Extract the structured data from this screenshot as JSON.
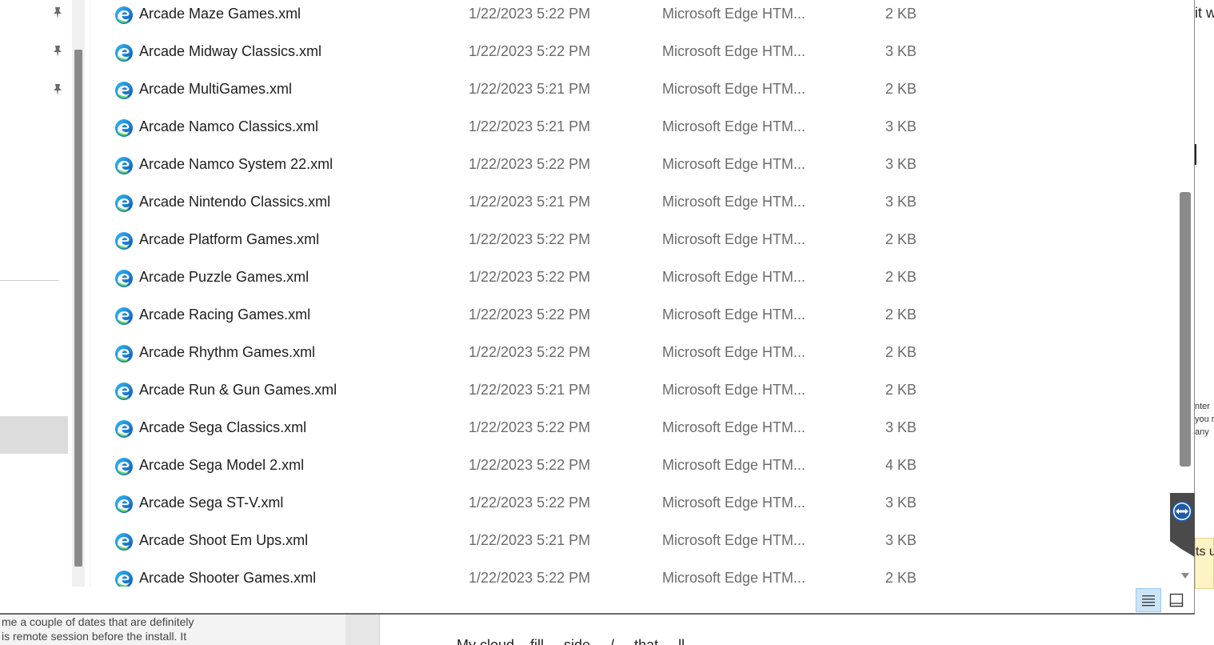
{
  "files": [
    {
      "name": "Arcade Maze Games.xml",
      "date": "1/22/2023 5:22 PM",
      "type": "Microsoft Edge HTM...",
      "size": "2 KB"
    },
    {
      "name": "Arcade Midway Classics.xml",
      "date": "1/22/2023 5:22 PM",
      "type": "Microsoft Edge HTM...",
      "size": "3 KB"
    },
    {
      "name": "Arcade MultiGames.xml",
      "date": "1/22/2023 5:21 PM",
      "type": "Microsoft Edge HTM...",
      "size": "2 KB"
    },
    {
      "name": "Arcade Namco Classics.xml",
      "date": "1/22/2023 5:21 PM",
      "type": "Microsoft Edge HTM...",
      "size": "3 KB"
    },
    {
      "name": "Arcade Namco System 22.xml",
      "date": "1/22/2023 5:22 PM",
      "type": "Microsoft Edge HTM...",
      "size": "3 KB"
    },
    {
      "name": "Arcade Nintendo Classics.xml",
      "date": "1/22/2023 5:21 PM",
      "type": "Microsoft Edge HTM...",
      "size": "3 KB"
    },
    {
      "name": "Arcade Platform Games.xml",
      "date": "1/22/2023 5:22 PM",
      "type": "Microsoft Edge HTM...",
      "size": "2 KB"
    },
    {
      "name": "Arcade Puzzle Games.xml",
      "date": "1/22/2023 5:22 PM",
      "type": "Microsoft Edge HTM...",
      "size": "2 KB"
    },
    {
      "name": "Arcade Racing Games.xml",
      "date": "1/22/2023 5:22 PM",
      "type": "Microsoft Edge HTM...",
      "size": "2 KB"
    },
    {
      "name": "Arcade Rhythm Games.xml",
      "date": "1/22/2023 5:22 PM",
      "type": "Microsoft Edge HTM...",
      "size": "2 KB"
    },
    {
      "name": "Arcade Run & Gun Games.xml",
      "date": "1/22/2023 5:21 PM",
      "type": "Microsoft Edge HTM...",
      "size": "2 KB"
    },
    {
      "name": "Arcade Sega Classics.xml",
      "date": "1/22/2023 5:22 PM",
      "type": "Microsoft Edge HTM...",
      "size": "3 KB"
    },
    {
      "name": "Arcade Sega Model 2.xml",
      "date": "1/22/2023 5:22 PM",
      "type": "Microsoft Edge HTM...",
      "size": "4 KB"
    },
    {
      "name": "Arcade Sega ST-V.xml",
      "date": "1/22/2023 5:22 PM",
      "type": "Microsoft Edge HTM...",
      "size": "3 KB"
    },
    {
      "name": "Arcade Shoot Em Ups.xml",
      "date": "1/22/2023 5:21 PM",
      "type": "Microsoft Edge HTM...",
      "size": "3 KB"
    },
    {
      "name": "Arcade Shooter Games.xml",
      "date": "1/22/2023 5:22 PM",
      "type": "Microsoft Edge HTM...",
      "size": "2 KB"
    }
  ],
  "file_icon": "microsoft-edge-icon",
  "nav_pins": [
    "pin-icon",
    "pin-icon",
    "pin-icon"
  ],
  "view_buttons": {
    "details": "details-view-icon",
    "large": "large-icons-view-icon"
  },
  "background": {
    "bottom_left_lines": [
      "me a couple of dates that are definitely",
      "is remote session before the install. It"
    ],
    "bottom_right_text": "My cloud... fill ... side ... / ... that ... ll ...",
    "right_edge_text": "it w",
    "right_edge_small": [
      "nter",
      "you r",
      "any"
    ],
    "right_note": "ts u"
  },
  "colors": {
    "accent": "#0078d4",
    "selected_view": "#cce4f7",
    "scroll_thumb": "#8a8a8a",
    "note": "#fdf3c4"
  }
}
